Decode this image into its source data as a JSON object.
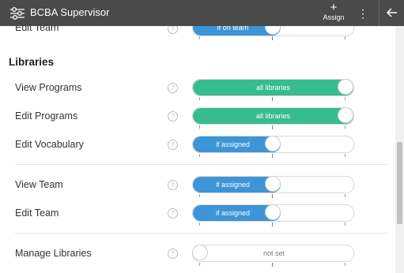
{
  "header": {
    "title": "BCBA Supervisor",
    "assign_label": "Assign",
    "assign_icon": "+",
    "more_icon": "⋮"
  },
  "colors": {
    "topbar": "#4a4a4a",
    "teal": "#36bc8f",
    "blue": "#3d94d6"
  },
  "sections": {
    "libraries_title": "Libraries"
  },
  "rows": {
    "edit_team_top": {
      "label": "Edit Team",
      "value": "if on team"
    },
    "view_programs": {
      "label": "View Programs",
      "value": "all libraries"
    },
    "edit_programs": {
      "label": "Edit Programs",
      "value": "all libraries"
    },
    "edit_vocabulary": {
      "label": "Edit Vocabulary",
      "value": "if assigned"
    },
    "view_team": {
      "label": "View Team",
      "value": "if assigned"
    },
    "edit_team": {
      "label": "Edit Team",
      "value": "if assigned"
    },
    "manage_libraries": {
      "label": "Manage Libraries",
      "value": "not set"
    }
  },
  "help_glyph": "?"
}
